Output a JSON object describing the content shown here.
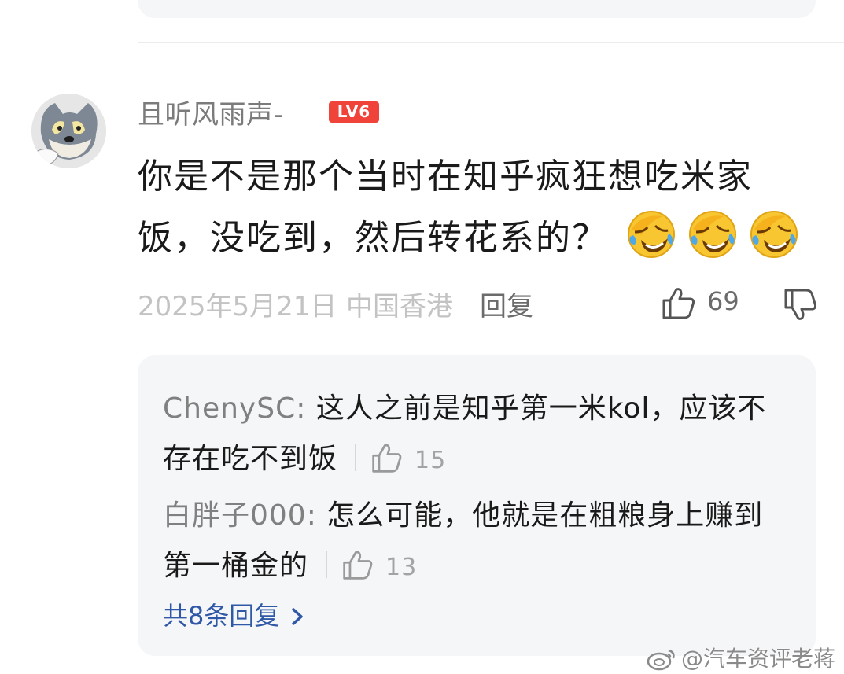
{
  "comment": {
    "username": "且听风雨声-",
    "level": "LV6",
    "text": "你是不是那个当时在知乎疯狂想吃米家饭，没吃到，然后转花系的？",
    "emojis": [
      "laughing-crying-emoji",
      "laughing-crying-emoji",
      "laughing-crying-emoji"
    ],
    "date": "2025年5月21日",
    "location": "中国香港",
    "reply_label": "回复",
    "likes": "69"
  },
  "replies": [
    {
      "author": "ChenySC:",
      "text": " 这人之前是知乎第一米kol，应该不存在吃不到饭",
      "likes": "15"
    },
    {
      "author": "白胖子000:",
      "text": " 怎么可能，他就是在粗粮身上赚到第一桶金的",
      "likes": "13"
    }
  ],
  "more_replies_label": "共8条回复",
  "watermark": "@汽车资评老蒋",
  "colors": {
    "level_badge": "#f0433a",
    "link_blue": "#2f58a6",
    "reply_bg": "#f5f6f8"
  }
}
